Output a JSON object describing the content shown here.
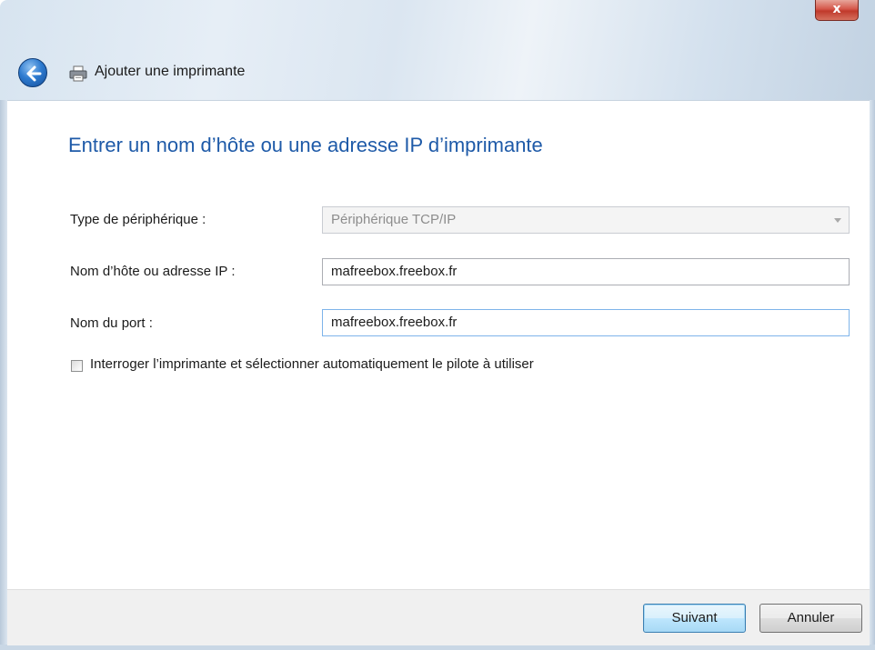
{
  "window": {
    "close_glyph": "x",
    "back_icon": "back-arrow-icon",
    "title_icon": "printer-icon",
    "title": "Ajouter une imprimante"
  },
  "page": {
    "heading": "Entrer un nom d’hôte ou une adresse IP d’imprimante"
  },
  "form": {
    "device_type": {
      "label": "Type de périphérique :",
      "value": "Périphérique TCP/IP",
      "disabled": true
    },
    "host": {
      "label": "Nom d’hôte ou adresse IP :",
      "value": "mafreebox.freebox.fr"
    },
    "port": {
      "label": "Nom du port :",
      "value": "mafreebox.freebox.fr"
    },
    "auto_driver": {
      "label": "Interroger l’imprimante et sélectionner automatiquement le pilote à utiliser",
      "checked": false
    }
  },
  "footer": {
    "next_label": "Suivant",
    "cancel_label": "Annuler"
  },
  "colors": {
    "heading": "#1e5aa8",
    "close_button": "#c0392b",
    "focus_border": "#7eb4ea"
  }
}
